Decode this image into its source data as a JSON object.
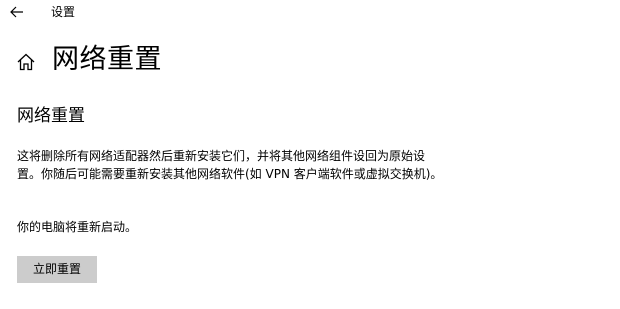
{
  "titlebar": {
    "back_icon": "back-arrow-icon",
    "title": "设置"
  },
  "header": {
    "home_icon": "home-icon",
    "title": "网络重置"
  },
  "main": {
    "section_title": "网络重置",
    "description": "这将删除所有网络适配器然后重新安装它们，并将其他网络组件设回为原始设置。你随后可能需要重新安装其他网络软件(如 VPN 客户端软件或虚拟交换机)。",
    "restart_note": "你的电脑将重新启动。",
    "reset_button_label": "立即重置",
    "button_color": "#cccccc"
  }
}
